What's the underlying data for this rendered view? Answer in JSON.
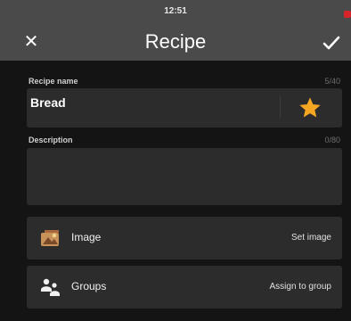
{
  "status_bar": {
    "time": "12:51"
  },
  "app_bar": {
    "title": "Recipe",
    "close_icon": "close-icon",
    "confirm_icon": "check-icon"
  },
  "form": {
    "name": {
      "label": "Recipe name",
      "counter": "5/40",
      "value": "Bread",
      "favorite_icon": "star-icon"
    },
    "description": {
      "label": "Description",
      "counter": "0/80",
      "value": ""
    }
  },
  "rows": [
    {
      "label": "Image",
      "action": "Set image",
      "icon": "image-icon"
    },
    {
      "label": "Groups",
      "action": "Assign to group",
      "icon": "groups-icon"
    }
  ],
  "colors": {
    "app_bar": "#4a4a4a",
    "background": "#141414",
    "field": "#2c2c2c",
    "star": "#f5a623",
    "status_indicator": "#d9232b"
  }
}
